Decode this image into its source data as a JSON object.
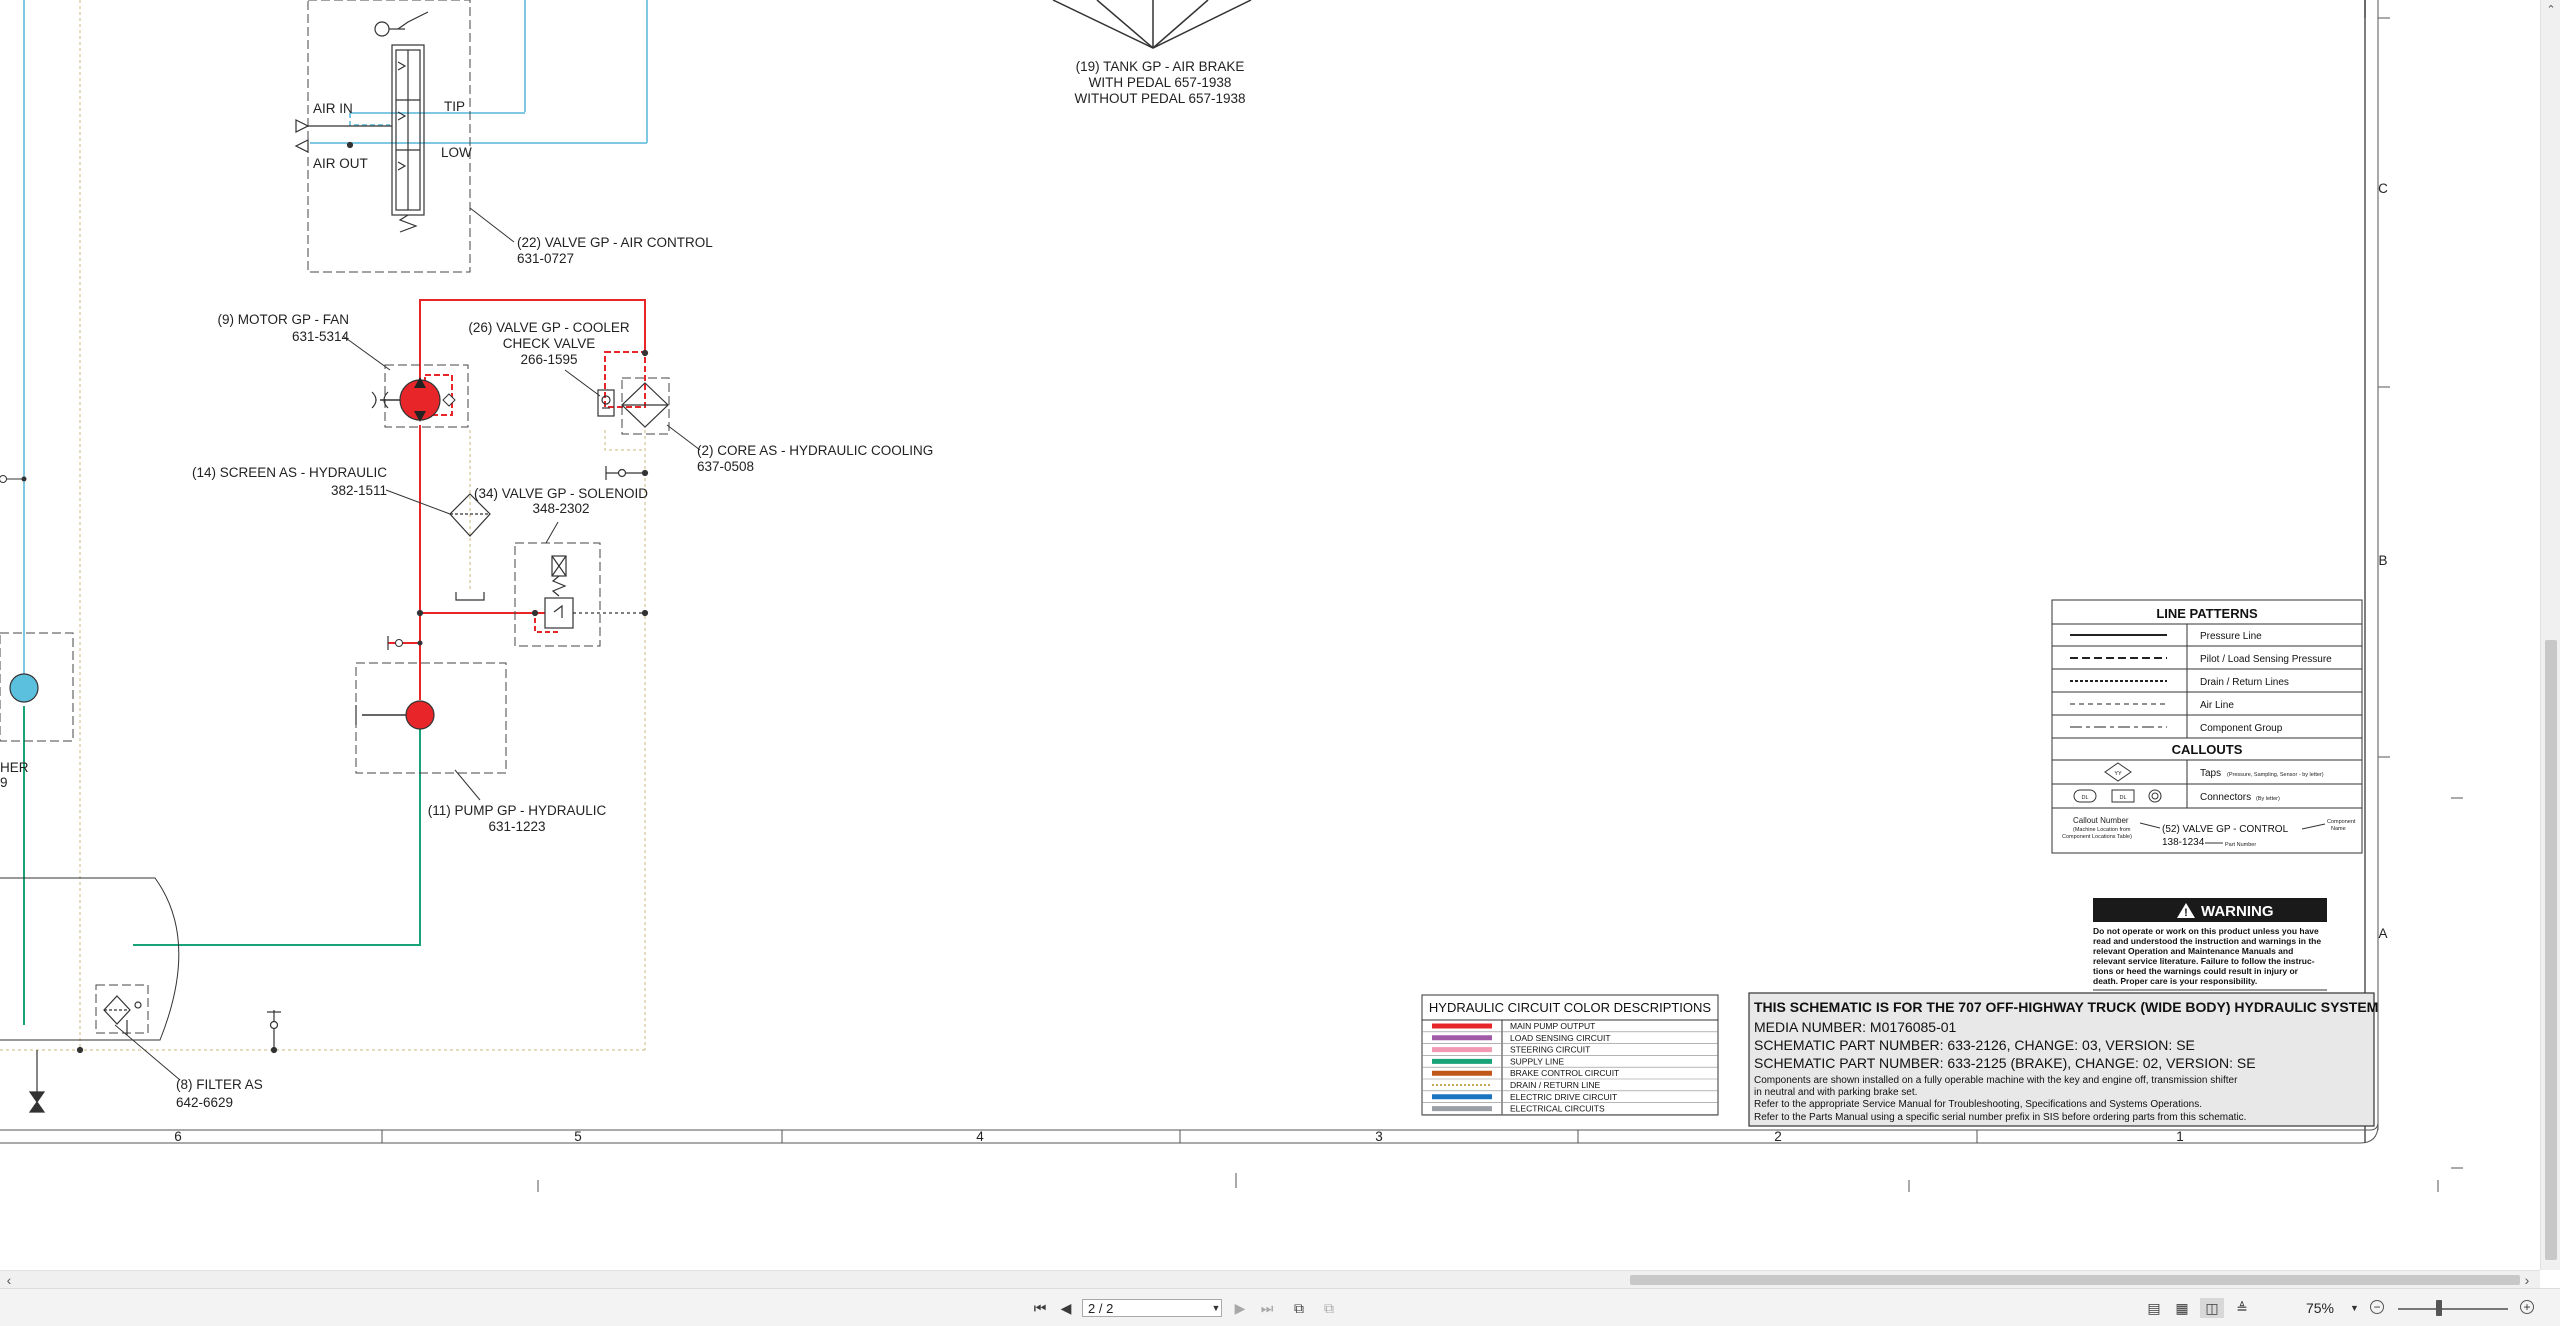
{
  "schematic": {
    "callouts": {
      "tank": [
        "(19) TANK GP - AIR BRAKE",
        "WITH PEDAL 657-1938",
        "WITHOUT PEDAL 657-1938"
      ],
      "air_control": [
        "(22) VALVE GP - AIR CONTROL",
        "631-0727"
      ],
      "motor_fan": [
        "(9) MOTOR GP - FAN",
        "631-5314"
      ],
      "cooler_check": [
        "(26) VALVE GP - COOLER",
        "CHECK VALVE",
        "266-1595"
      ],
      "core_cooling": [
        "(2) CORE AS - HYDRAULIC COOLING",
        "637-0508"
      ],
      "screen": [
        "(14) SCREEN AS - HYDRAULIC",
        "382-1511"
      ],
      "solenoid": [
        "(34) VALVE GP - SOLENOID",
        "348-2302"
      ],
      "pump": [
        "(11) PUMP GP - HYDRAULIC",
        "631-1223"
      ],
      "filter": [
        "(8) FILTER AS",
        "642-6629"
      ],
      "partial_left": [
        "HER",
        "9"
      ]
    },
    "valve_labels": {
      "air_in": "AIR IN",
      "air_out": "AIR OUT",
      "tip": "TIP",
      "low": "LOW"
    },
    "zone_columns": [
      "6",
      "5",
      "4",
      "3",
      "2",
      "1"
    ],
    "zone_rows": [
      "C",
      "B",
      "A"
    ],
    "line_patterns": {
      "title": "LINE PATTERNS",
      "rows": [
        "Pressure Line",
        "Pilot / Load Sensing Pressure",
        "Drain / Return Lines",
        "Air Line",
        "Component Group"
      ],
      "callouts_title": "CALLOUTS",
      "taps": "Taps",
      "taps_note": "(Pressure, Sampling, Sensor - by letter)",
      "tap_symbol": "YY",
      "connectors": "Connectors",
      "connectors_note": "(By letter)",
      "connector_symbol": "DL",
      "callout_number": "Callout Number",
      "callout_number_note": [
        "(Machine Location from",
        "Component Locations Table)"
      ],
      "example_name": "(52) VALVE GP - CONTROL",
      "example_part": "138-1234",
      "part_number": "Part Number",
      "component_name": [
        "Component",
        "Name"
      ]
    },
    "warning": {
      "title": "WARNING",
      "lines": [
        "Do not operate or work on this product unless you have",
        "read and understood the instruction and warnings in the",
        "relevant Operation and Maintenance Manuals and",
        "relevant service literature. Failure to follow the instruc-",
        "tions or heed the warnings could result in injury or",
        "death. Proper care is your responsibility."
      ]
    },
    "color_legend": {
      "title": "HYDRAULIC CIRCUIT COLOR DESCRIPTIONS",
      "items": [
        {
          "label": "MAIN PUMP OUTPUT",
          "color": "#e8262a",
          "style": "solid"
        },
        {
          "label": "LOAD SENSING CIRCUIT",
          "color": "#a05aa8",
          "style": "solid"
        },
        {
          "label": "STEERING CIRCUIT",
          "color": "#f29ab4",
          "style": "solid"
        },
        {
          "label": "SUPPLY LINE",
          "color": "#1aa278",
          "style": "solid"
        },
        {
          "label": "BRAKE CONTROL CIRCUIT",
          "color": "#c2571a",
          "style": "solid"
        },
        {
          "label": "DRAIN / RETURN LINE",
          "color": "#c8a95a",
          "style": "dotted"
        },
        {
          "label": "ELECTRIC DRIVE CIRCUIT",
          "color": "#1a74c0",
          "style": "solid"
        },
        {
          "label": "ELECTRICAL CIRCUITS",
          "color": "#9aa0a6",
          "style": "solid"
        }
      ]
    },
    "title_block": {
      "heading": "THIS SCHEMATIC IS FOR THE 707 OFF-HIGHWAY TRUCK (WIDE BODY) HYDRAULIC SYSTEM",
      "media": "MEDIA NUMBER: M0176085-01",
      "part1": "SCHEMATIC PART NUMBER: 633-2126, CHANGE: 03, VERSION: SE",
      "part2": "SCHEMATIC PART NUMBER: 633-2125 (BRAKE), CHANGE: 02, VERSION: SE",
      "notes": [
        "Components are shown installed on a fully operable machine with the key and engine off, transmission shifter",
        "in neutral and with parking brake set.",
        "Refer to the appropriate Service Manual for Troubleshooting, Specifications and Systems Operations.",
        "Refer to the Parts Manual using a specific serial number prefix in SIS before ordering parts from this schematic."
      ]
    },
    "colors": {
      "pressure": "#e8262a",
      "supply": "#1aa278",
      "air": "#7ec8e3",
      "drain": "#c8b97a",
      "pump_fill": "#e8262a",
      "motor_fill": "#e8262a",
      "accumulator_fill": "#5bc0de"
    }
  },
  "toolbar": {
    "page_field": "2 / 2",
    "zoom": "75%"
  }
}
